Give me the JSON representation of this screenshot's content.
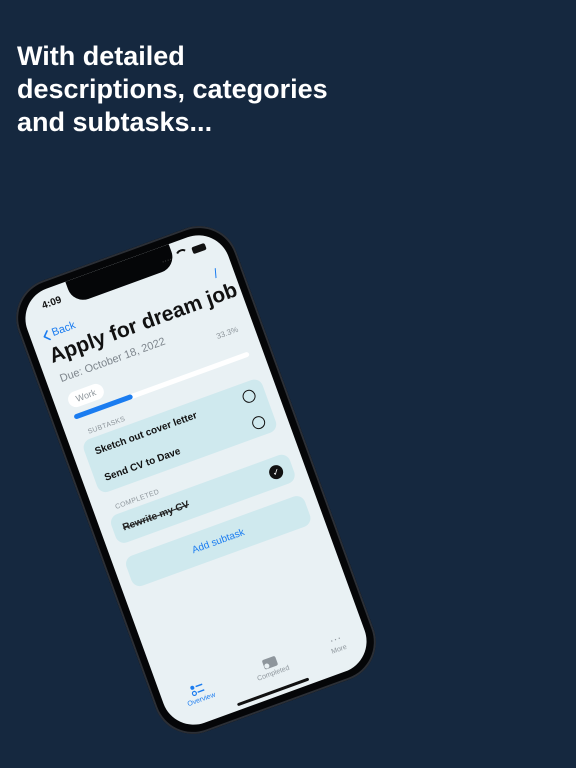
{
  "headline": {
    "line1": "With detailed",
    "line2": "descriptions, categories",
    "line3": "and subtasks..."
  },
  "status": {
    "time": "4:09",
    "signal": "····"
  },
  "nav": {
    "back_label": "Back",
    "edit_glyph": "/"
  },
  "task": {
    "title": "Apply for dream job",
    "due": "Due: October 18, 2022",
    "category": "Work",
    "progress_percent": "33.3%",
    "progress_fraction": 0.333
  },
  "subtasks": {
    "section_label": "SUBTASKS",
    "items": [
      {
        "label": "Sketch out cover letter"
      },
      {
        "label": "Send CV to Dave"
      }
    ]
  },
  "completed": {
    "section_label": "COMPLETED",
    "items": [
      {
        "label": "Rewrite my CV",
        "check": "✓"
      }
    ]
  },
  "add_subtask_label": "Add subtask",
  "tabbar": {
    "overview_label": "Overview",
    "completed_label": "Completed",
    "more_label": "More",
    "more_glyph": "···"
  },
  "colors": {
    "background": "#15283f",
    "accent": "#1a7cf0",
    "card": "#cfe9ee",
    "screen": "#e9f1f4"
  },
  "icons": [
    "back-chevron-icon",
    "edit-pencil-icon",
    "wifi-icon",
    "battery-icon",
    "checkmark-icon",
    "list-icon",
    "completed-tray-icon",
    "more-dots-icon"
  ]
}
